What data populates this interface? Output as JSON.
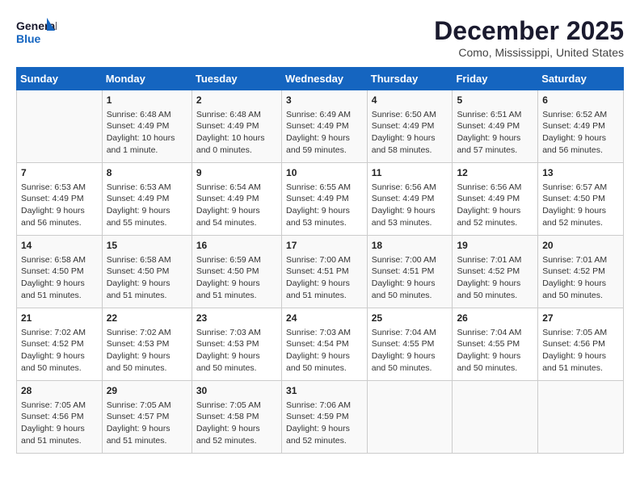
{
  "logo": {
    "general": "General",
    "blue": "Blue"
  },
  "title": "December 2025",
  "subtitle": "Como, Mississippi, United States",
  "days_of_week": [
    "Sunday",
    "Monday",
    "Tuesday",
    "Wednesday",
    "Thursday",
    "Friday",
    "Saturday"
  ],
  "weeks": [
    [
      {
        "day": "",
        "info": ""
      },
      {
        "day": "1",
        "info": "Sunrise: 6:48 AM\nSunset: 4:49 PM\nDaylight: 10 hours\nand 1 minute."
      },
      {
        "day": "2",
        "info": "Sunrise: 6:48 AM\nSunset: 4:49 PM\nDaylight: 10 hours\nand 0 minutes."
      },
      {
        "day": "3",
        "info": "Sunrise: 6:49 AM\nSunset: 4:49 PM\nDaylight: 9 hours\nand 59 minutes."
      },
      {
        "day": "4",
        "info": "Sunrise: 6:50 AM\nSunset: 4:49 PM\nDaylight: 9 hours\nand 58 minutes."
      },
      {
        "day": "5",
        "info": "Sunrise: 6:51 AM\nSunset: 4:49 PM\nDaylight: 9 hours\nand 57 minutes."
      },
      {
        "day": "6",
        "info": "Sunrise: 6:52 AM\nSunset: 4:49 PM\nDaylight: 9 hours\nand 56 minutes."
      }
    ],
    [
      {
        "day": "7",
        "info": "Sunrise: 6:53 AM\nSunset: 4:49 PM\nDaylight: 9 hours\nand 56 minutes."
      },
      {
        "day": "8",
        "info": "Sunrise: 6:53 AM\nSunset: 4:49 PM\nDaylight: 9 hours\nand 55 minutes."
      },
      {
        "day": "9",
        "info": "Sunrise: 6:54 AM\nSunset: 4:49 PM\nDaylight: 9 hours\nand 54 minutes."
      },
      {
        "day": "10",
        "info": "Sunrise: 6:55 AM\nSunset: 4:49 PM\nDaylight: 9 hours\nand 53 minutes."
      },
      {
        "day": "11",
        "info": "Sunrise: 6:56 AM\nSunset: 4:49 PM\nDaylight: 9 hours\nand 53 minutes."
      },
      {
        "day": "12",
        "info": "Sunrise: 6:56 AM\nSunset: 4:49 PM\nDaylight: 9 hours\nand 52 minutes."
      },
      {
        "day": "13",
        "info": "Sunrise: 6:57 AM\nSunset: 4:50 PM\nDaylight: 9 hours\nand 52 minutes."
      }
    ],
    [
      {
        "day": "14",
        "info": "Sunrise: 6:58 AM\nSunset: 4:50 PM\nDaylight: 9 hours\nand 51 minutes."
      },
      {
        "day": "15",
        "info": "Sunrise: 6:58 AM\nSunset: 4:50 PM\nDaylight: 9 hours\nand 51 minutes."
      },
      {
        "day": "16",
        "info": "Sunrise: 6:59 AM\nSunset: 4:50 PM\nDaylight: 9 hours\nand 51 minutes."
      },
      {
        "day": "17",
        "info": "Sunrise: 7:00 AM\nSunset: 4:51 PM\nDaylight: 9 hours\nand 51 minutes."
      },
      {
        "day": "18",
        "info": "Sunrise: 7:00 AM\nSunset: 4:51 PM\nDaylight: 9 hours\nand 50 minutes."
      },
      {
        "day": "19",
        "info": "Sunrise: 7:01 AM\nSunset: 4:52 PM\nDaylight: 9 hours\nand 50 minutes."
      },
      {
        "day": "20",
        "info": "Sunrise: 7:01 AM\nSunset: 4:52 PM\nDaylight: 9 hours\nand 50 minutes."
      }
    ],
    [
      {
        "day": "21",
        "info": "Sunrise: 7:02 AM\nSunset: 4:52 PM\nDaylight: 9 hours\nand 50 minutes."
      },
      {
        "day": "22",
        "info": "Sunrise: 7:02 AM\nSunset: 4:53 PM\nDaylight: 9 hours\nand 50 minutes."
      },
      {
        "day": "23",
        "info": "Sunrise: 7:03 AM\nSunset: 4:53 PM\nDaylight: 9 hours\nand 50 minutes."
      },
      {
        "day": "24",
        "info": "Sunrise: 7:03 AM\nSunset: 4:54 PM\nDaylight: 9 hours\nand 50 minutes."
      },
      {
        "day": "25",
        "info": "Sunrise: 7:04 AM\nSunset: 4:55 PM\nDaylight: 9 hours\nand 50 minutes."
      },
      {
        "day": "26",
        "info": "Sunrise: 7:04 AM\nSunset: 4:55 PM\nDaylight: 9 hours\nand 50 minutes."
      },
      {
        "day": "27",
        "info": "Sunrise: 7:05 AM\nSunset: 4:56 PM\nDaylight: 9 hours\nand 51 minutes."
      }
    ],
    [
      {
        "day": "28",
        "info": "Sunrise: 7:05 AM\nSunset: 4:56 PM\nDaylight: 9 hours\nand 51 minutes."
      },
      {
        "day": "29",
        "info": "Sunrise: 7:05 AM\nSunset: 4:57 PM\nDaylight: 9 hours\nand 51 minutes."
      },
      {
        "day": "30",
        "info": "Sunrise: 7:05 AM\nSunset: 4:58 PM\nDaylight: 9 hours\nand 52 minutes."
      },
      {
        "day": "31",
        "info": "Sunrise: 7:06 AM\nSunset: 4:59 PM\nDaylight: 9 hours\nand 52 minutes."
      },
      {
        "day": "",
        "info": ""
      },
      {
        "day": "",
        "info": ""
      },
      {
        "day": "",
        "info": ""
      }
    ]
  ]
}
